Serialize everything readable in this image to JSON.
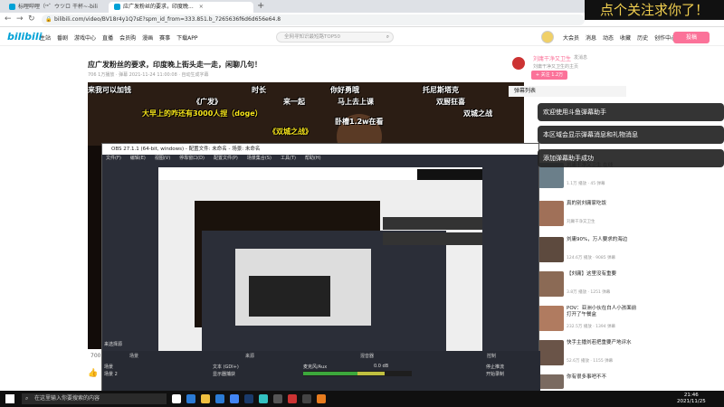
{
  "browser": {
    "tabs": [
      {
        "label": "标哩哔哩（ʳᵉ゜ウツロ 干杯~-bili"
      },
      {
        "label": "应广发粉丝的要求，印度晚..."
      }
    ],
    "url": "bilibili.com/video/BV18r4y1Q7sE?spm_id_from=333.851.b_7265636f6d6d656e64.8"
  },
  "overlay_text": "点个关注求你了！",
  "site_nav": {
    "logo": "bilibili",
    "items": [
      "主站",
      "番剧",
      "游戏中心",
      "直播",
      "会员购",
      "漫画",
      "赛事",
      "下载APP"
    ],
    "search_placeholder": "全网寻知识最短路TOP50",
    "right_items": [
      "大会员",
      "消息",
      "动态",
      "收藏",
      "历史",
      "创作中心"
    ],
    "upload": "投稿"
  },
  "video": {
    "title": "应广发粉丝的要求，印度晚上街头走一走，闲聊几句！",
    "meta": "706 1万播放 · 弹幕 2021-11-24 11:00:08 · 自动生成字幕",
    "player_count": "700",
    "danmaku": [
      {
        "text": "来我可以加钱",
        "color": "#ffffff"
      },
      {
        "text": "时长",
        "color": "#ffffff"
      },
      {
        "text": "你好勇哦",
        "color": "#ffffff"
      },
      {
        "text": "托尼斯塔克",
        "color": "#ffffff"
      },
      {
        "text": "《广发》",
        "color": "#ffffff"
      },
      {
        "text": "来一起",
        "color": "#ffffff"
      },
      {
        "text": "马上去上课",
        "color": "#ffffff"
      },
      {
        "text": "双厨狂喜",
        "color": "#ffffff"
      },
      {
        "text": "大早上的咋还有3000人捏（doge）",
        "color": "#f7e51a"
      },
      {
        "text": "卧槽1.2w在看",
        "color": "#ffffff"
      },
      {
        "text": "双城之战",
        "color": "#ffffff"
      },
      {
        "text": "《双城之战》",
        "color": "#f7e51a"
      }
    ]
  },
  "obs": {
    "title": "OBS 27.1.1 (64-bit, windows) - 配置文件: 未命名 - 场景: 未命名",
    "menu": [
      "文件(F)",
      "编辑(E)",
      "视图(V)",
      "停靠窗口(D)",
      "配置文件(P)",
      "场景集合(S)",
      "工具(T)",
      "帮助(H)"
    ],
    "panels": [
      "场景",
      "来源",
      "混音器",
      "场景转换",
      "控制"
    ],
    "scenes": [
      "场景",
      "场景 2"
    ],
    "sources": [
      "文本 (GDI+)",
      "显示器捕获"
    ],
    "mixer_channel": "麦克风/Aux",
    "mixer_db": "0.0 dB",
    "controls": [
      "停止推流",
      "开始录制"
    ],
    "filter_label": "来选择源"
  },
  "uploader": {
    "name": "刘庸干净又卫生",
    "charge": "发消息",
    "desc": "刘庸干净又卫生的主页",
    "follow": "+ 关注 1.2万"
  },
  "danmaku_list_head": "弹幕列表",
  "notifications": [
    "欢迎使用斗鱼弹幕助手",
    "本区域会显示弹幕消息和礼物消息",
    "添加弹幕助手成功"
  ],
  "recommendations": [
    {
      "title": "刘庸干净又卫生 在线",
      "meta": "1.1万 播放 · 45 弹幕"
    },
    {
      "title": "真的别刘庸家吃饭",
      "meta": "刘庸干净又卫生"
    },
    {
      "title": "刘庸90%，万人要求的海边",
      "meta": "124.6万 播放 · 9085 弹幕"
    },
    {
      "title": "【刘庸】这里没有重要",
      "meta": "3.8万 播放 · 1251 弹幕"
    },
    {
      "title": "POV：亚洲小伙在白人小孩面前打开了午餐盒",
      "meta": "232.5万 播放 · 1394 弹幕"
    },
    {
      "title": "快手主播刘若把重要产地评水",
      "meta": "52.6万 播放 · 1155 弹幕"
    },
    {
      "title": "你有很多事吧不不",
      "meta": ""
    }
  ],
  "taskbar": {
    "search_placeholder": "在这里输入你要搜索的内容",
    "time": "21:46",
    "date": "2021/11/25"
  }
}
